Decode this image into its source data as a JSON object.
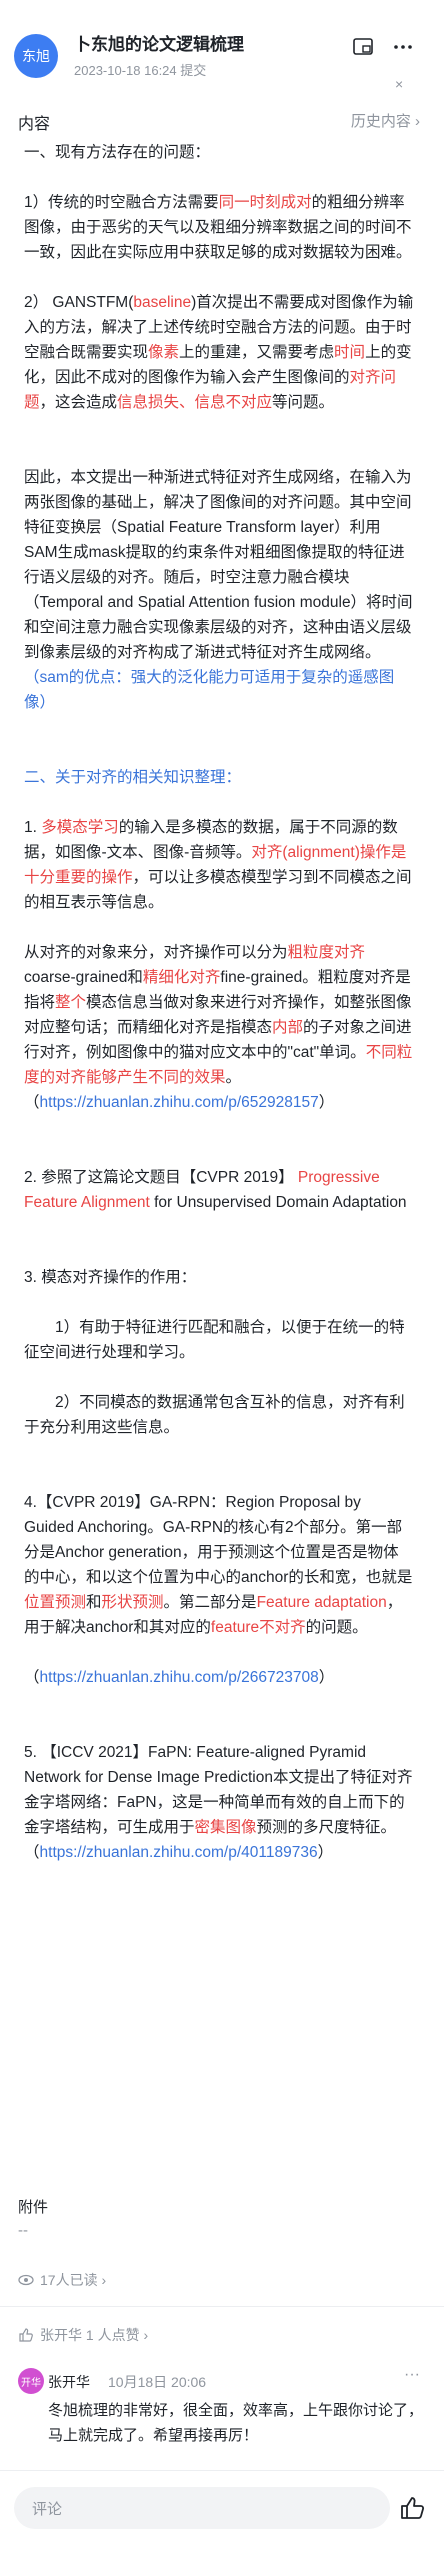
{
  "header": {
    "avatar_text": "东旭",
    "title": "卜东旭的论文逻辑梳理",
    "meta": "2023-10-18 16:24 提交",
    "close_text": "×"
  },
  "section": {
    "label": "内容",
    "history": "历史内容 ›"
  },
  "article": {
    "p1": "一、现有方法存在的问题：",
    "p2": [
      {
        "t": "1）传统的时空融合方法需要"
      },
      {
        "t": "同一时刻成对",
        "c": "red"
      },
      {
        "t": "的粗细分辨率图像，由于恶劣的天气以及粗细分辨率数据之间的时间不一致，因此在实际应用中获取足够的成对数据较为困难。"
      }
    ],
    "p3": [
      {
        "t": "2） GANSTFM("
      },
      {
        "t": "baseline",
        "c": "red"
      },
      {
        "t": ")首次提出不需要成对图像作为输入的方法，解决了上述传统时空融合方法的问题。由于时空融合既需要实现"
      },
      {
        "t": "像素",
        "c": "red"
      },
      {
        "t": "上的重建，又需要考虑"
      },
      {
        "t": "时间",
        "c": "red"
      },
      {
        "t": "上的变化，因此不成对的图像作为输入会产生图像间的"
      },
      {
        "t": "对齐问题",
        "c": "red"
      },
      {
        "t": "，这会造成"
      },
      {
        "t": "信息损失、信息不对应",
        "c": "red"
      },
      {
        "t": "等问题。"
      }
    ],
    "p4": [
      {
        "t": "因此，本文提出一种渐进式特征对齐生成网络，在输入为两张图像的基础上，解决了图像间的对齐问题。其中空间特征变换层（Spatial Feature Transform layer）利用SAM生成mask提取的约束条件对粗细图像提取的特征进行语义层级的对齐。随后，时空注意力融合模块（Temporal and Spatial Attention fusion module）将时间和空间注意力融合实现像素层级的对齐，这种由语义层级到像素层级的对齐构成了渐进式特征对齐生成网络。"
      },
      {
        "t": "（sam的优点：强大的泛化能力可适用于复杂的遥感图像）",
        "c": "blue"
      }
    ],
    "p5": "二、关于对齐的相关知识整理：",
    "p6": [
      {
        "t": "1. "
      },
      {
        "t": "多模态学习",
        "c": "red"
      },
      {
        "t": "的输入是多模态的数据，属于不同源的数据，如图像-文本、图像-音频等。"
      },
      {
        "t": "对齐(alignment)操作是十分重要的操作",
        "c": "red"
      },
      {
        "t": "，可以让多模态模型学习到不同模态之间的相互表示等信息。"
      }
    ],
    "p7": [
      {
        "t": "从对齐的对象来分，对齐操作可以分为"
      },
      {
        "t": "粗粒度对齐",
        "c": "red"
      },
      {
        "t": "coarse-grained和"
      },
      {
        "t": "精细化对齐",
        "c": "red"
      },
      {
        "t": "fine-grained。粗粒度对齐是指将"
      },
      {
        "t": "整个",
        "c": "red"
      },
      {
        "t": "模态信息当做对象来进行对齐操作，如整张图像对应整句话；而精细化对齐是指模态"
      },
      {
        "t": "内部",
        "c": "red"
      },
      {
        "t": "的子对象之间进行对齐，例如图像中的猫对应文本中的\"cat\"单词。"
      },
      {
        "t": "不同粒度的对齐能够产生不同的效果",
        "c": "red"
      },
      {
        "t": "。 （"
      },
      {
        "t": "https://zhuanlan.zhihu.com/p/652928157",
        "c": "blue"
      },
      {
        "t": "）"
      }
    ],
    "p8": [
      {
        "t": "2. 参照了这篇论文题目【CVPR 2019】 "
      },
      {
        "t": "Progressive Feature Alignment",
        "c": "red"
      },
      {
        "t": " for Unsupervised Domain Adaptation"
      }
    ],
    "p9": "3. 模态对齐操作的作用：",
    "p10": "1）有助于特征进行匹配和融合，以便于在统一的特征空间进行处理和学习。",
    "p11": "2）不同模态的数据通常包含互补的信息，对齐有利于充分利用这些信息。",
    "p12": [
      {
        "t": "4.【CVPR 2019】GA-RPN：Region Proposal by Guided Anchoring。GA-RPN的核心有2个部分。第一部分是Anchor generation，用于预测这个位置是否是物体的中心，和以这个位置为中心的anchor的长和宽，也就是"
      },
      {
        "t": "位置预测",
        "c": "red"
      },
      {
        "t": "和"
      },
      {
        "t": "形状预测",
        "c": "red"
      },
      {
        "t": "。第二部分是"
      },
      {
        "t": "Feature adaptation",
        "c": "red"
      },
      {
        "t": "，用于解决anchor和其对应的"
      },
      {
        "t": "feature不对齐",
        "c": "red"
      },
      {
        "t": "的问题。"
      }
    ],
    "p13": [
      {
        "t": "（"
      },
      {
        "t": "https://zhuanlan.zhihu.com/p/266723708",
        "c": "blue"
      },
      {
        "t": "）"
      }
    ],
    "p14": [
      {
        "t": "5. 【ICCV 2021】FaPN: Feature-aligned Pyramid Network for Dense Image Prediction本文提出了特征对齐金字塔网络：FaPN，这是一种简单而有效的自上而下的金字塔结构，可生成用于"
      },
      {
        "t": "密集图像",
        "c": "red"
      },
      {
        "t": "预测的多尺度特征。（"
      },
      {
        "t": "https://zhuanlan.zhihu.com/p/401189736",
        "c": "blue"
      },
      {
        "t": "）"
      }
    ]
  },
  "attachments": {
    "label": "附件",
    "placeholder": "--"
  },
  "readers": {
    "text": "17人已读 ›"
  },
  "likes": {
    "text": "张开华 1 人点赞 ›"
  },
  "comment": {
    "avatar_text": "开华",
    "author": "张开华",
    "time": "10月18日 20:06",
    "more": "···",
    "text": "冬旭梳理的非常好，很全面，效率高，上午跟你讨论了，马上就完成了。希望再接再厉！"
  },
  "input": {
    "placeholder": "评论"
  }
}
